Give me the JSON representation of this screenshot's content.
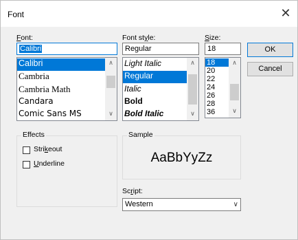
{
  "window": {
    "title": "Font",
    "close_glyph": "✕"
  },
  "font": {
    "label_mnemonic": "F",
    "label_rest": "ont:",
    "value": "Calibri",
    "items": [
      {
        "label": "Calibri",
        "selected": true
      },
      {
        "label": "Cambria",
        "selected": false
      },
      {
        "label": "Cambria Math",
        "selected": false
      },
      {
        "label": "Candara",
        "selected": false
      },
      {
        "label": "Comic Sans MS",
        "selected": false
      }
    ]
  },
  "style": {
    "label_prefix": "Font st",
    "label_mnemonic": "y",
    "label_rest": "le:",
    "value": "Regular",
    "items": [
      {
        "label": "Light Italic",
        "selected": false
      },
      {
        "label": "Regular",
        "selected": true
      },
      {
        "label": "Italic",
        "selected": false
      },
      {
        "label": "Bold",
        "selected": false
      },
      {
        "label": "Bold Italic",
        "selected": false
      }
    ]
  },
  "size": {
    "label_mnemonic": "S",
    "label_rest": "ize:",
    "value": "18",
    "items": [
      "18",
      "20",
      "22",
      "24",
      "26",
      "28",
      "36"
    ],
    "selected_index": 0
  },
  "buttons": {
    "ok": "OK",
    "cancel": "Cancel"
  },
  "effects": {
    "title": "Effects",
    "strikeout": {
      "prefix": "Stri",
      "mnemonic": "k",
      "rest": "eout",
      "checked": false
    },
    "underline": {
      "prefix": "",
      "mnemonic": "U",
      "rest": "nderline",
      "checked": false
    }
  },
  "sample": {
    "title": "Sample",
    "text": "AaBbYyZz"
  },
  "script": {
    "label_prefix": "Sc",
    "label_mnemonic": "r",
    "label_rest": "ipt:",
    "value": "Western"
  },
  "colors": {
    "accent": "#0078d7",
    "dialog_bg": "#f0f0f0"
  },
  "icons": {
    "scroll_up": "chevron-up-icon",
    "scroll_down": "chevron-down-icon",
    "combo": "chevron-down-icon"
  }
}
